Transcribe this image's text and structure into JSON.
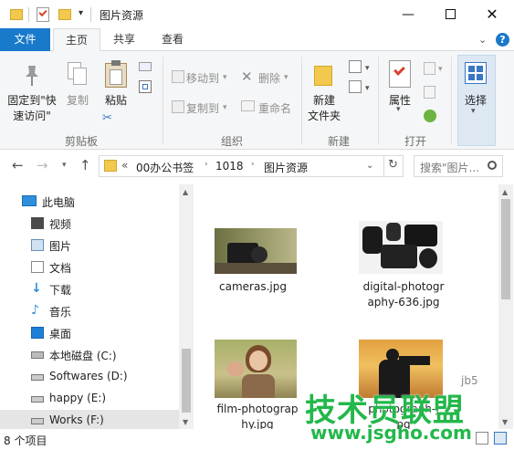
{
  "window": {
    "title": "图片资源"
  },
  "tabs": [
    {
      "label": "文件"
    },
    {
      "label": "主页"
    },
    {
      "label": "共享"
    },
    {
      "label": "查看"
    }
  ],
  "ribbon": {
    "pin_label_1": "固定到\"快",
    "pin_label_2": "速访问\"",
    "copy": "复制",
    "paste": "粘贴",
    "move_to": "移动到",
    "copy_to": "复制到",
    "delete": "删除",
    "rename": "重命名",
    "new_folder_1": "新建",
    "new_folder_2": "文件夹",
    "properties": "属性",
    "select": "选择",
    "groups": {
      "clipboard": "剪贴板",
      "organize": "组织",
      "new": "新建",
      "open": "打开"
    }
  },
  "address": {
    "overflow": "«",
    "crumbs": [
      "00办公书签",
      "1018",
      "图片资源"
    ],
    "search_placeholder": "搜索\"图片..."
  },
  "nav_pane": {
    "items": [
      {
        "label": "此电脑",
        "icon": "computer-icon"
      },
      {
        "label": "视频",
        "icon": "video-folder-icon"
      },
      {
        "label": "图片",
        "icon": "pictures-folder-icon"
      },
      {
        "label": "文档",
        "icon": "documents-folder-icon"
      },
      {
        "label": "下载",
        "icon": "downloads-folder-icon"
      },
      {
        "label": "音乐",
        "icon": "music-folder-icon"
      },
      {
        "label": "桌面",
        "icon": "desktop-folder-icon"
      },
      {
        "label": "本地磁盘 (C:)",
        "icon": "drive-c-icon"
      },
      {
        "label": "Softwares (D:)",
        "icon": "drive-icon"
      },
      {
        "label": "happy (E:)",
        "icon": "drive-icon"
      },
      {
        "label": "Works (F:)",
        "icon": "drive-icon"
      }
    ]
  },
  "files": [
    {
      "name_1": "cameras.jpg",
      "name_2": ""
    },
    {
      "name_1": "digital-photogr",
      "name_2": "aphy-636.jpg"
    },
    {
      "name_1": "film-photograp",
      "name_2": "hy.jpg"
    },
    {
      "name_1": "photograph-j",
      "name_2": "pg"
    }
  ],
  "status": {
    "count": "8 个项目"
  },
  "watermark": {
    "brand": "技术员联盟",
    "url": "www.jsgho.com",
    "side_text": "jb5"
  }
}
